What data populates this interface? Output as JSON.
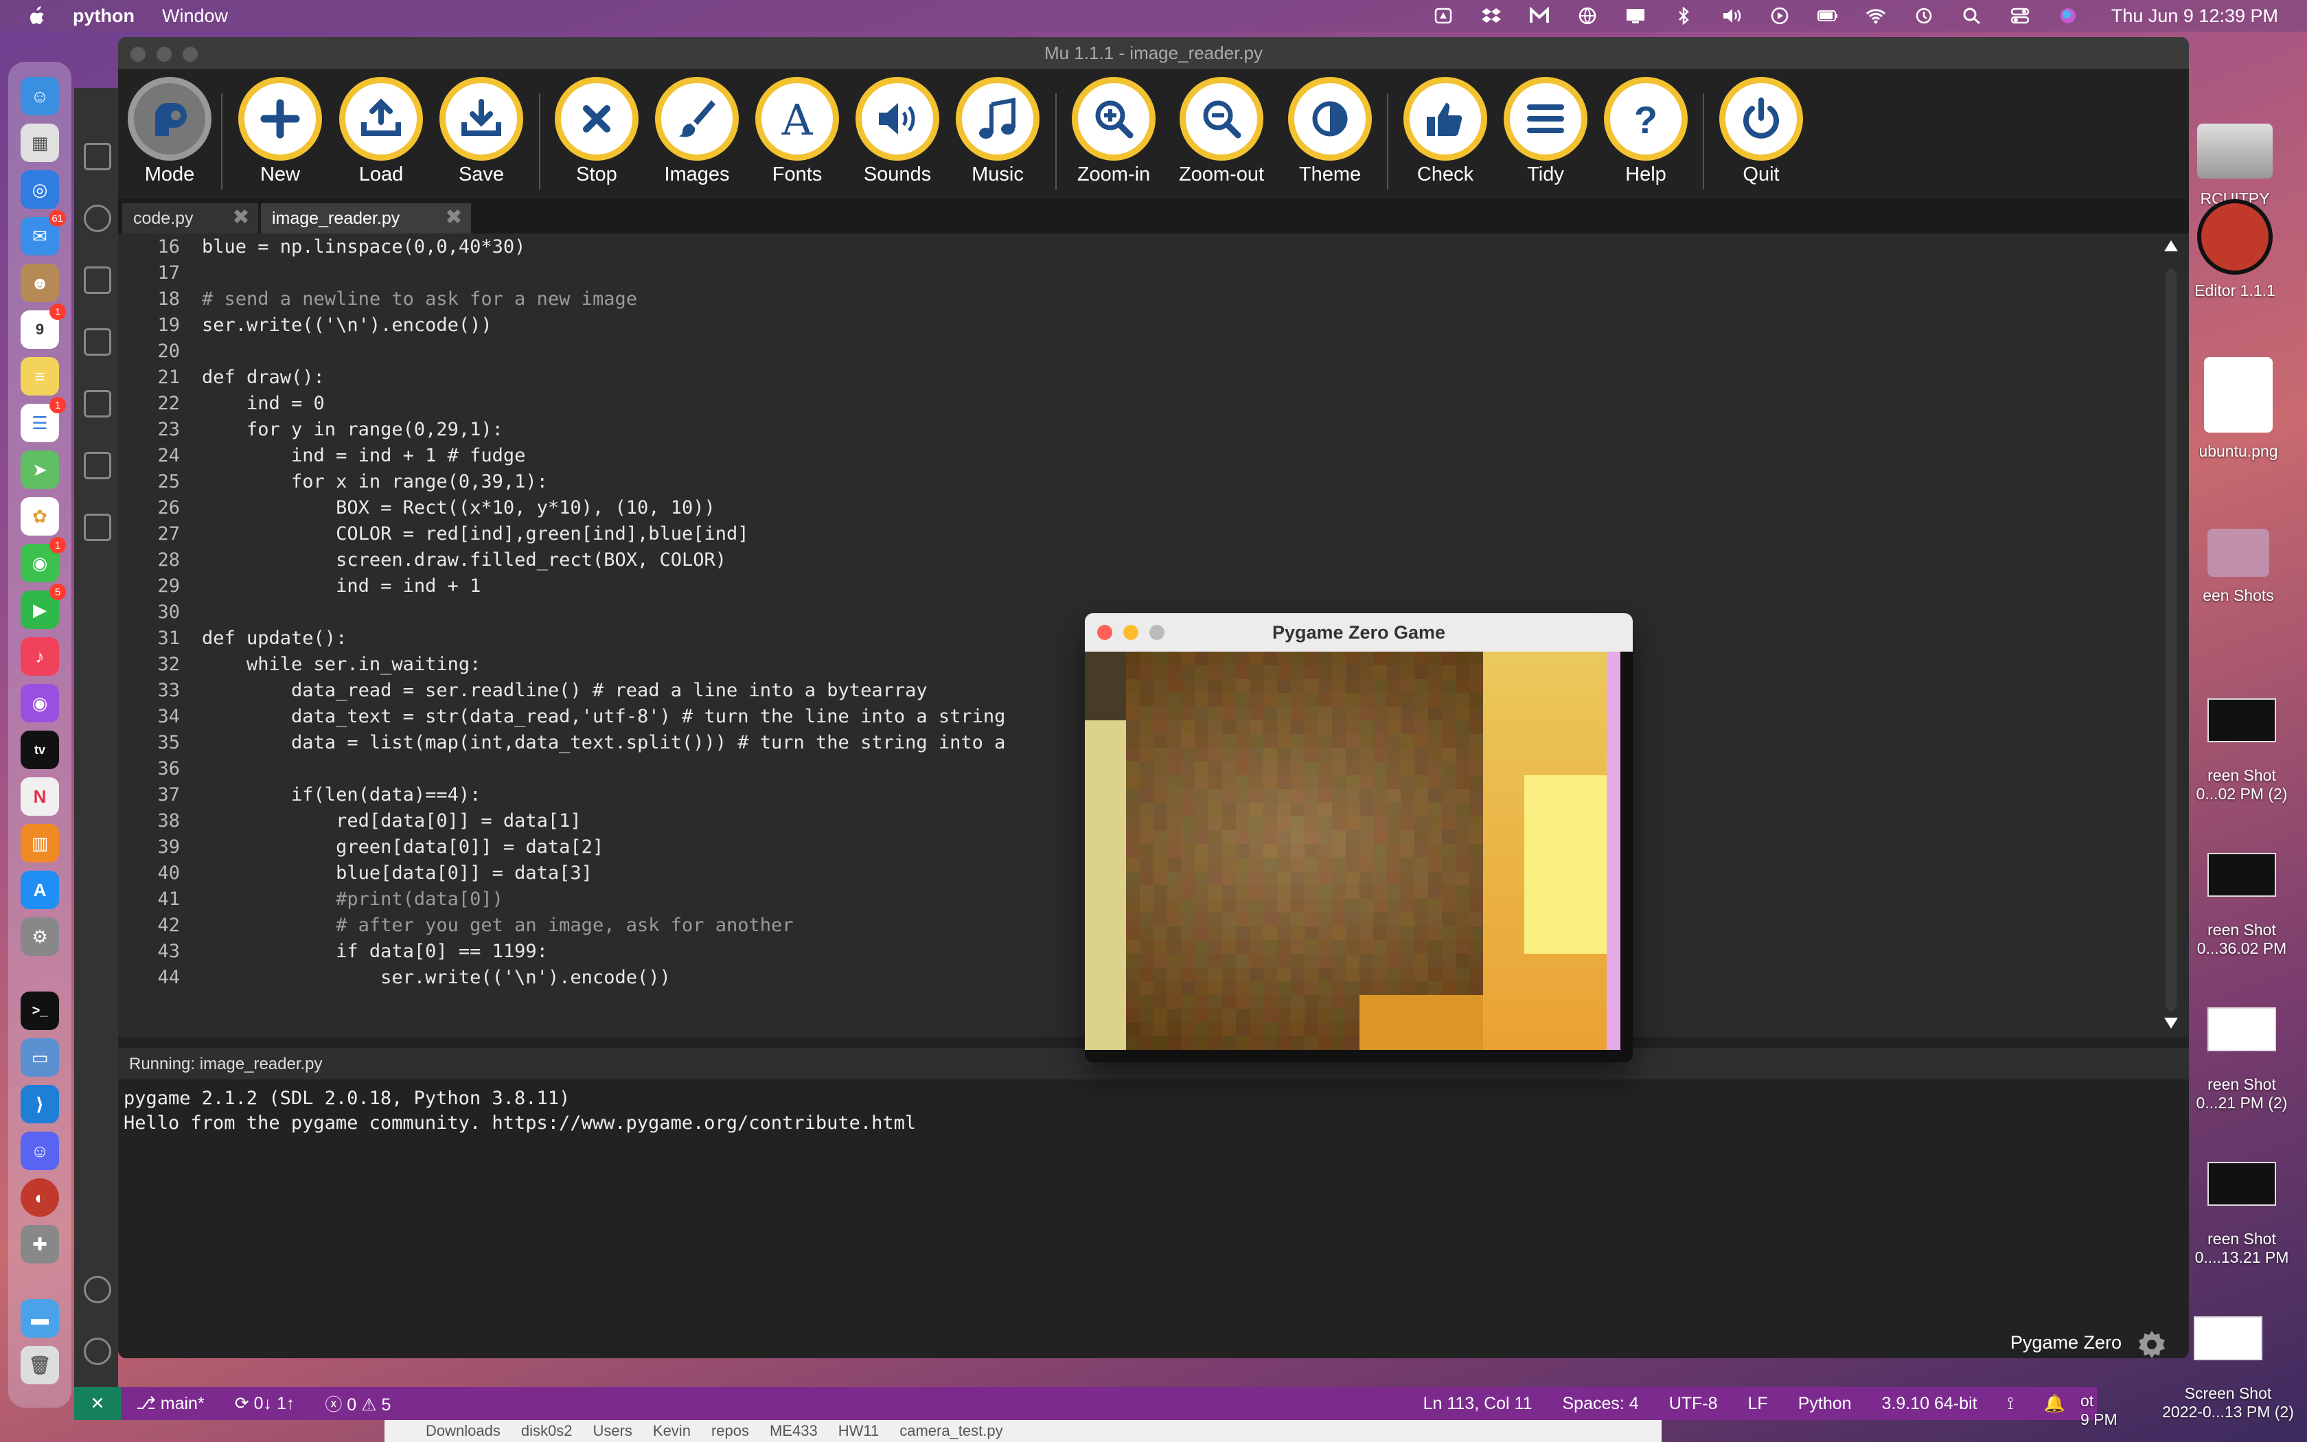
{
  "menubar": {
    "app_name": "python",
    "menu_window": "Window",
    "clock": "Thu Jun 9  12:39 PM"
  },
  "mu": {
    "title": "Mu 1.1.1 - image_reader.py",
    "toolbar": [
      {
        "label": "Mode",
        "icon": "mode-icon"
      },
      {
        "label": "New",
        "icon": "plus-icon"
      },
      {
        "label": "Load",
        "icon": "upload-icon"
      },
      {
        "label": "Save",
        "icon": "download-icon"
      },
      {
        "label": "Stop",
        "icon": "stop-x-icon"
      },
      {
        "label": "Images",
        "icon": "brush-icon"
      },
      {
        "label": "Fonts",
        "icon": "font-icon"
      },
      {
        "label": "Sounds",
        "icon": "speaker-icon"
      },
      {
        "label": "Music",
        "icon": "music-note-icon"
      },
      {
        "label": "Zoom-in",
        "icon": "zoom-in-icon"
      },
      {
        "label": "Zoom-out",
        "icon": "zoom-out-icon"
      },
      {
        "label": "Theme",
        "icon": "theme-icon"
      },
      {
        "label": "Check",
        "icon": "thumbs-up-icon"
      },
      {
        "label": "Tidy",
        "icon": "tidy-lines-icon"
      },
      {
        "label": "Help",
        "icon": "question-icon"
      },
      {
        "label": "Quit",
        "icon": "power-icon"
      }
    ],
    "tabs": [
      {
        "label": "code.py"
      },
      {
        "label": "image_reader.py"
      }
    ],
    "line_numbers": [
      "16",
      "17",
      "18",
      "19",
      "20",
      "21",
      "22",
      "23",
      "24",
      "25",
      "26",
      "27",
      "28",
      "29",
      "30",
      "31",
      "32",
      "33",
      "34",
      "35",
      "36",
      "37",
      "38",
      "39",
      "40",
      "41",
      "42",
      "43",
      "44"
    ],
    "code_lines": [
      "blue = np.linspace(0,0,40*30)",
      "",
      "# send a newline to ask for a new image",
      "ser.write(('\\n').encode())",
      "",
      "def draw():",
      "    ind = 0",
      "    for y in range(0,29,1):",
      "        ind = ind + 1 # fudge",
      "        for x in range(0,39,1):",
      "            BOX = Rect((x*10, y*10), (10, 10))",
      "            COLOR = red[ind],green[ind],blue[ind]",
      "            screen.draw.filled_rect(BOX, COLOR)",
      "            ind = ind + 1",
      "",
      "def update():",
      "    while ser.in_waiting:",
      "        data_read = ser.readline() # read a line into a bytearray",
      "        data_text = str(data_read,'utf-8') # turn the line into a string",
      "        data = list(map(int,data_text.split())) # turn the string into a",
      "",
      "        if(len(data)==4):",
      "            red[data[0]] = data[1]",
      "            green[data[0]] = data[2]",
      "            blue[data[0]] = data[3]",
      "            #print(data[0])",
      "            # after you get an image, ask for another",
      "            if data[0] == 1199:",
      "                ser.write(('\\n').encode())"
    ],
    "running_label": "Running: image_reader.py",
    "console_lines": [
      "pygame 2.1.2 (SDL 2.0.18, Python 3.8.11)",
      "Hello from the pygame community. https://www.pygame.org/contribute.html"
    ],
    "mode_label": "Pygame Zero"
  },
  "pygame": {
    "title": "Pygame Zero Game"
  },
  "vscode_status": {
    "branch": "main*",
    "sync": "0↓ 1↑",
    "problems": "ⓧ 0 ⚠ 5",
    "position": "Ln 113, Col 11",
    "spaces": "Spaces: 4",
    "encoding": "UTF-8",
    "eol": "LF",
    "language": "Python",
    "interpreter": "3.9.10 64-bit"
  },
  "breadcrumbs": [
    "Downloads",
    "disk0s2",
    "Users",
    "Kevin",
    "repos",
    "ME433",
    "HW11",
    "camera_test.py"
  ],
  "desktop": [
    {
      "label": "RCUITPY"
    },
    {
      "label": "Editor 1.1.1"
    },
    {
      "label": "ubuntu.png"
    },
    {
      "label": "een Shots"
    },
    {
      "label": "reen Shot\n0...02 PM (2)"
    },
    {
      "label": "reen Shot\n0...36.02 PM"
    },
    {
      "label": "reen Shot\n0...21 PM (2)"
    },
    {
      "label": "reen Shot\n0....13.21 PM"
    },
    {
      "label": "Screen Shot\n2022-0...13 PM (2)"
    },
    {
      "label": "ot\n9 PM"
    }
  ],
  "dock_badges": [
    "61",
    "1",
    "1",
    "1",
    "5"
  ]
}
